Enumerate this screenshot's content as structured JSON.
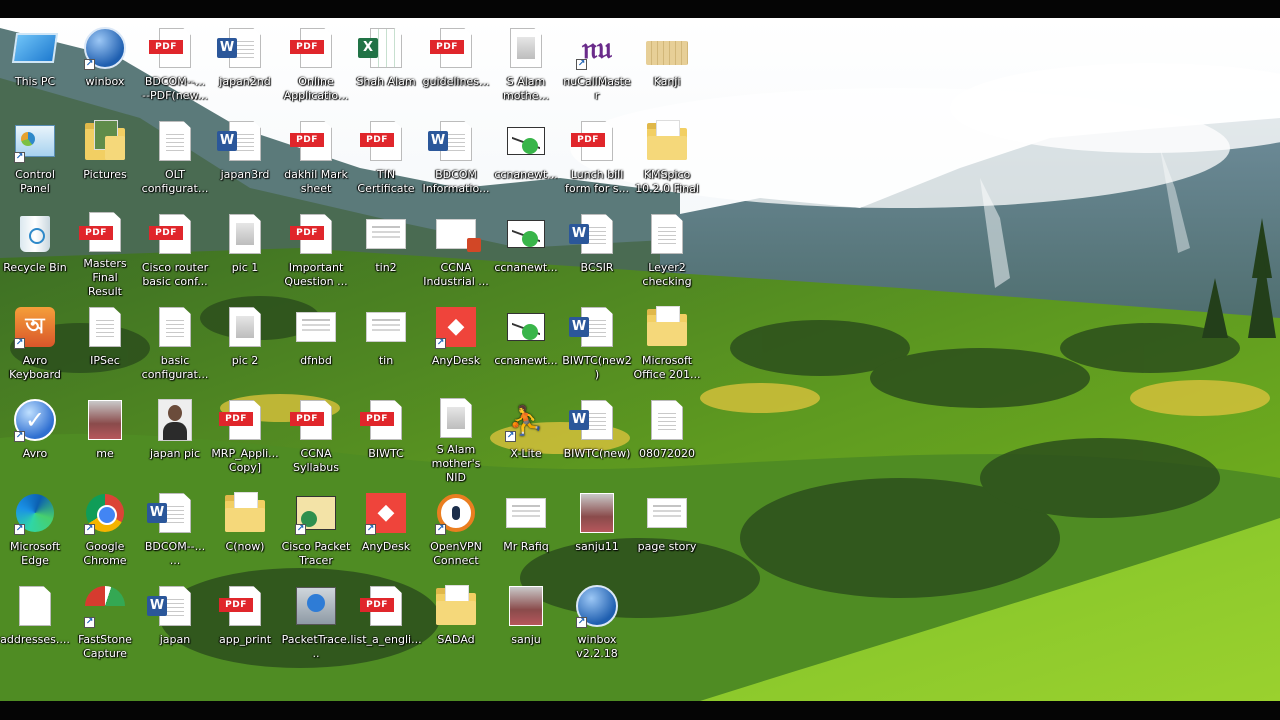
{
  "desktop": {
    "icons": [
      {
        "label": "This PC",
        "icon": "this-pc-icon"
      },
      {
        "label": "winbox",
        "icon": "winbox-icon"
      },
      {
        "label": "BDCOM--...\n--PDF(new...",
        "icon": "pdf-file-icon"
      },
      {
        "label": "japan2nd",
        "icon": "word-document-icon"
      },
      {
        "label": "Online\nApplicatio...",
        "icon": "pdf-file-icon"
      },
      {
        "label": "Shah Alam",
        "icon": "excel-document-icon"
      },
      {
        "label": "guidelines...",
        "icon": "pdf-file-icon"
      },
      {
        "label": "S Alam\nmothe...",
        "icon": "image-file-icon"
      },
      {
        "label": "nuCallMaster",
        "icon": "nucallmaster-icon"
      },
      {
        "label": "Kanji",
        "icon": "rar-archive-icon"
      },
      {
        "label": "Control\nPanel",
        "icon": "control-panel-icon"
      },
      {
        "label": "Pictures",
        "icon": "pictures-folder-icon"
      },
      {
        "label": "OLT\nconfigurat...",
        "icon": "text-file-icon"
      },
      {
        "label": "japan3rd",
        "icon": "word-document-icon"
      },
      {
        "label": "dakhil Mark\nsheet",
        "icon": "pdf-file-icon"
      },
      {
        "label": "TIN\nCertificate",
        "icon": "pdf-file-icon"
      },
      {
        "label": "BDCOM\nInformatio...",
        "icon": "word-document-icon"
      },
      {
        "label": "ccnanewt...",
        "icon": "packet-tracer-file-icon"
      },
      {
        "label": "Lunch bill\nform for s...",
        "icon": "pdf-file-icon"
      },
      {
        "label": "KMSpico\n10.2.0 Final",
        "icon": "folder-icon"
      },
      {
        "label": "Recycle Bin",
        "icon": "recycle-bin-icon"
      },
      {
        "label": "Masters Final\nResult",
        "icon": "pdf-file-icon"
      },
      {
        "label": "Cisco router\nbasic conf...",
        "icon": "pdf-file-icon"
      },
      {
        "label": "pic 1",
        "icon": "image-file-icon"
      },
      {
        "label": "Important\nQuestion ...",
        "icon": "pdf-file-icon"
      },
      {
        "label": "tin2",
        "icon": "image-thumbnail-icon"
      },
      {
        "label": "CCNA\nIndustrial ...",
        "icon": "powerpoint-thumbnail-icon"
      },
      {
        "label": "ccnanewt...",
        "icon": "packet-tracer-file-icon"
      },
      {
        "label": "BCSIR",
        "icon": "word-document-icon"
      },
      {
        "label": "Leyer2\nchecking",
        "icon": "text-file-icon"
      },
      {
        "label": "Avro\nKeyboard",
        "icon": "avro-keyboard-icon"
      },
      {
        "label": "IPSec",
        "icon": "text-file-icon"
      },
      {
        "label": "basic\nconfigurat...",
        "icon": "text-file-icon"
      },
      {
        "label": "pic 2",
        "icon": "image-file-icon"
      },
      {
        "label": "dfnbd",
        "icon": "image-thumbnail-icon"
      },
      {
        "label": "tin",
        "icon": "image-thumbnail-icon"
      },
      {
        "label": "AnyDesk",
        "icon": "anydesk-icon"
      },
      {
        "label": "ccnanewt...",
        "icon": "packet-tracer-file-icon"
      },
      {
        "label": "BIWTC(new2)",
        "icon": "word-document-icon"
      },
      {
        "label": "Microsoft\nOffice 201...",
        "icon": "folder-icon"
      },
      {
        "label": "Avro",
        "icon": "avro-check-icon"
      },
      {
        "label": "me",
        "icon": "photo-icon"
      },
      {
        "label": "japan pic",
        "icon": "portrait-photo-icon"
      },
      {
        "label": "MRP_Appli...\nCopy]",
        "icon": "pdf-file-icon"
      },
      {
        "label": "CCNA\nSyllabus",
        "icon": "pdf-file-icon"
      },
      {
        "label": "BIWTC",
        "icon": "pdf-file-icon"
      },
      {
        "label": "S Alam\nmother's NID",
        "icon": "image-file-icon"
      },
      {
        "label": "X-Lite",
        "icon": "xlite-icon"
      },
      {
        "label": "BIWTC(new)",
        "icon": "word-document-icon"
      },
      {
        "label": "08072020",
        "icon": "text-file-icon"
      },
      {
        "label": "Microsoft\nEdge",
        "icon": "edge-icon"
      },
      {
        "label": "Google\nChrome",
        "icon": "chrome-icon"
      },
      {
        "label": "BDCOM--...\n...",
        "icon": "word-document-icon"
      },
      {
        "label": "C(now)",
        "icon": "folder-icon"
      },
      {
        "label": "Cisco Packet\nTracer",
        "icon": "cisco-packet-tracer-icon"
      },
      {
        "label": "AnyDesk",
        "icon": "anydesk-icon"
      },
      {
        "label": "OpenVPN\nConnect",
        "icon": "openvpn-icon"
      },
      {
        "label": "Mr Rafiq",
        "icon": "image-thumbnail-icon"
      },
      {
        "label": "sanju11",
        "icon": "photo-icon"
      },
      {
        "label": "page story",
        "icon": "image-thumbnail-icon"
      },
      {
        "label": "addresses....",
        "icon": "blank-file-icon"
      },
      {
        "label": "FastStone\nCapture",
        "icon": "faststone-capture-icon"
      },
      {
        "label": "japan",
        "icon": "word-document-icon"
      },
      {
        "label": "app_print",
        "icon": "pdf-file-icon"
      },
      {
        "label": "PacketTrace...",
        "icon": "installer-icon"
      },
      {
        "label": "list_a_engli...",
        "icon": "pdf-file-icon"
      },
      {
        "label": "SADAd",
        "icon": "folder-icon"
      },
      {
        "label": "sanju",
        "icon": "photo-icon"
      },
      {
        "label": "winbox\nv2.2.18",
        "icon": "winbox-icon"
      }
    ]
  },
  "text": {
    "pdf": "PDF",
    "word": "W",
    "excel": "X",
    "shortcut": "↗",
    "anydesk": "◆"
  }
}
